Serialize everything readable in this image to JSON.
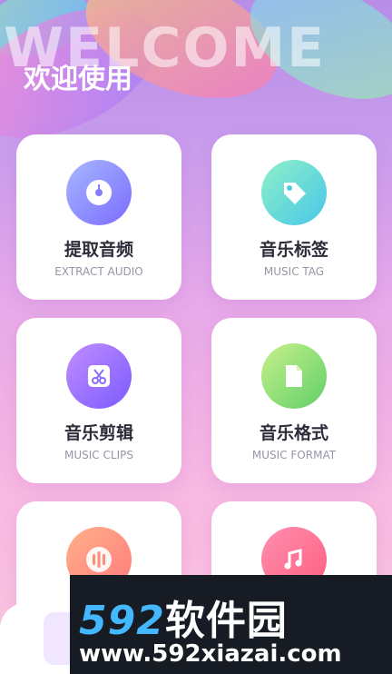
{
  "header": {
    "background_text": "WELCOME",
    "title": "欢迎使用"
  },
  "cards": [
    {
      "title": "提取音频",
      "subtitle": "EXTRACT AUDIO",
      "icon": "music-disc-icon",
      "gradient": [
        "#a7b7ff",
        "#7b6cff"
      ]
    },
    {
      "title": "音乐标签",
      "subtitle": "MUSIC TAG",
      "icon": "tag-icon",
      "gradient": [
        "#8ff0c8",
        "#49c7e8"
      ]
    },
    {
      "title": "音乐剪辑",
      "subtitle": "MUSIC CLIPS",
      "icon": "scissors-icon",
      "gradient": [
        "#c08cff",
        "#7c5cff"
      ]
    },
    {
      "title": "音乐格式",
      "subtitle": "MUSIC FORMAT",
      "icon": "file-icon",
      "gradient": [
        "#c8f08a",
        "#5fd06a"
      ]
    },
    {
      "title": "",
      "subtitle": "",
      "icon": "audio-wave-icon",
      "gradient": [
        "#ffb08a",
        "#ff7b7b"
      ]
    },
    {
      "title": "",
      "subtitle": "",
      "icon": "music-note-icon",
      "gradient": [
        "#ff8fb0",
        "#ff5f7f"
      ]
    }
  ],
  "watermark": {
    "logo_num": "592",
    "logo_text": "软件园",
    "url": "www.592xiazai.com"
  }
}
